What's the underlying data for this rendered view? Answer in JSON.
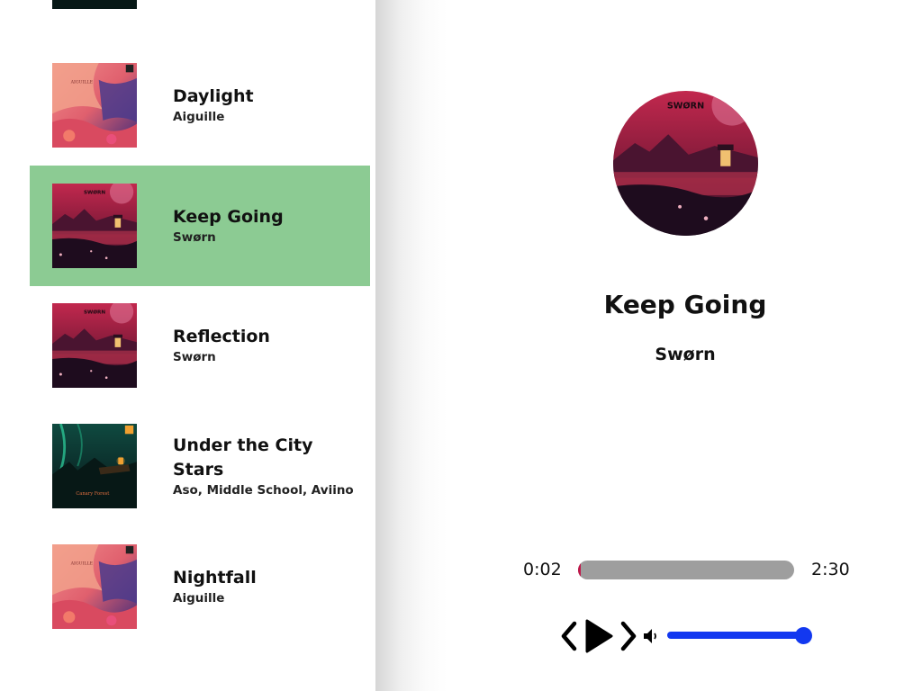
{
  "library": {
    "songs": [
      {
        "name": "Under the City Stars",
        "artist": "Aso, Middle School, Aviino",
        "cover": "green-forest",
        "active": false
      },
      {
        "name": "Daylight",
        "artist": "Aiguille",
        "cover": "pink-sky",
        "active": false
      },
      {
        "name": "Keep Going",
        "artist": "Swørn",
        "cover": "red-lake",
        "active": true
      },
      {
        "name": "Reflection",
        "artist": "Swørn",
        "cover": "red-lake",
        "active": false
      },
      {
        "name": "Under the City Stars",
        "artist": "Aso, Middle School, Aviino",
        "cover": "green-forest",
        "active": false
      },
      {
        "name": "Nightfall",
        "artist": "Aiguille",
        "cover": "pink-sky",
        "active": false
      }
    ]
  },
  "player": {
    "title": "Keep Going",
    "artist": "Swørn",
    "cover": "red-lake",
    "time_current": "0:02",
    "time_total": "2:30",
    "progress_fraction": 0.013,
    "volume_fraction": 1.0
  },
  "colors": {
    "active_song_bg": "#8ccb93",
    "progress_track": "#9e9e9e",
    "progress_fill": "#c0174a",
    "volume": "#1238f0"
  },
  "icons": {
    "prev": "chevron-left-icon",
    "play": "play-icon",
    "next": "chevron-right-icon",
    "volume": "volume-icon"
  }
}
